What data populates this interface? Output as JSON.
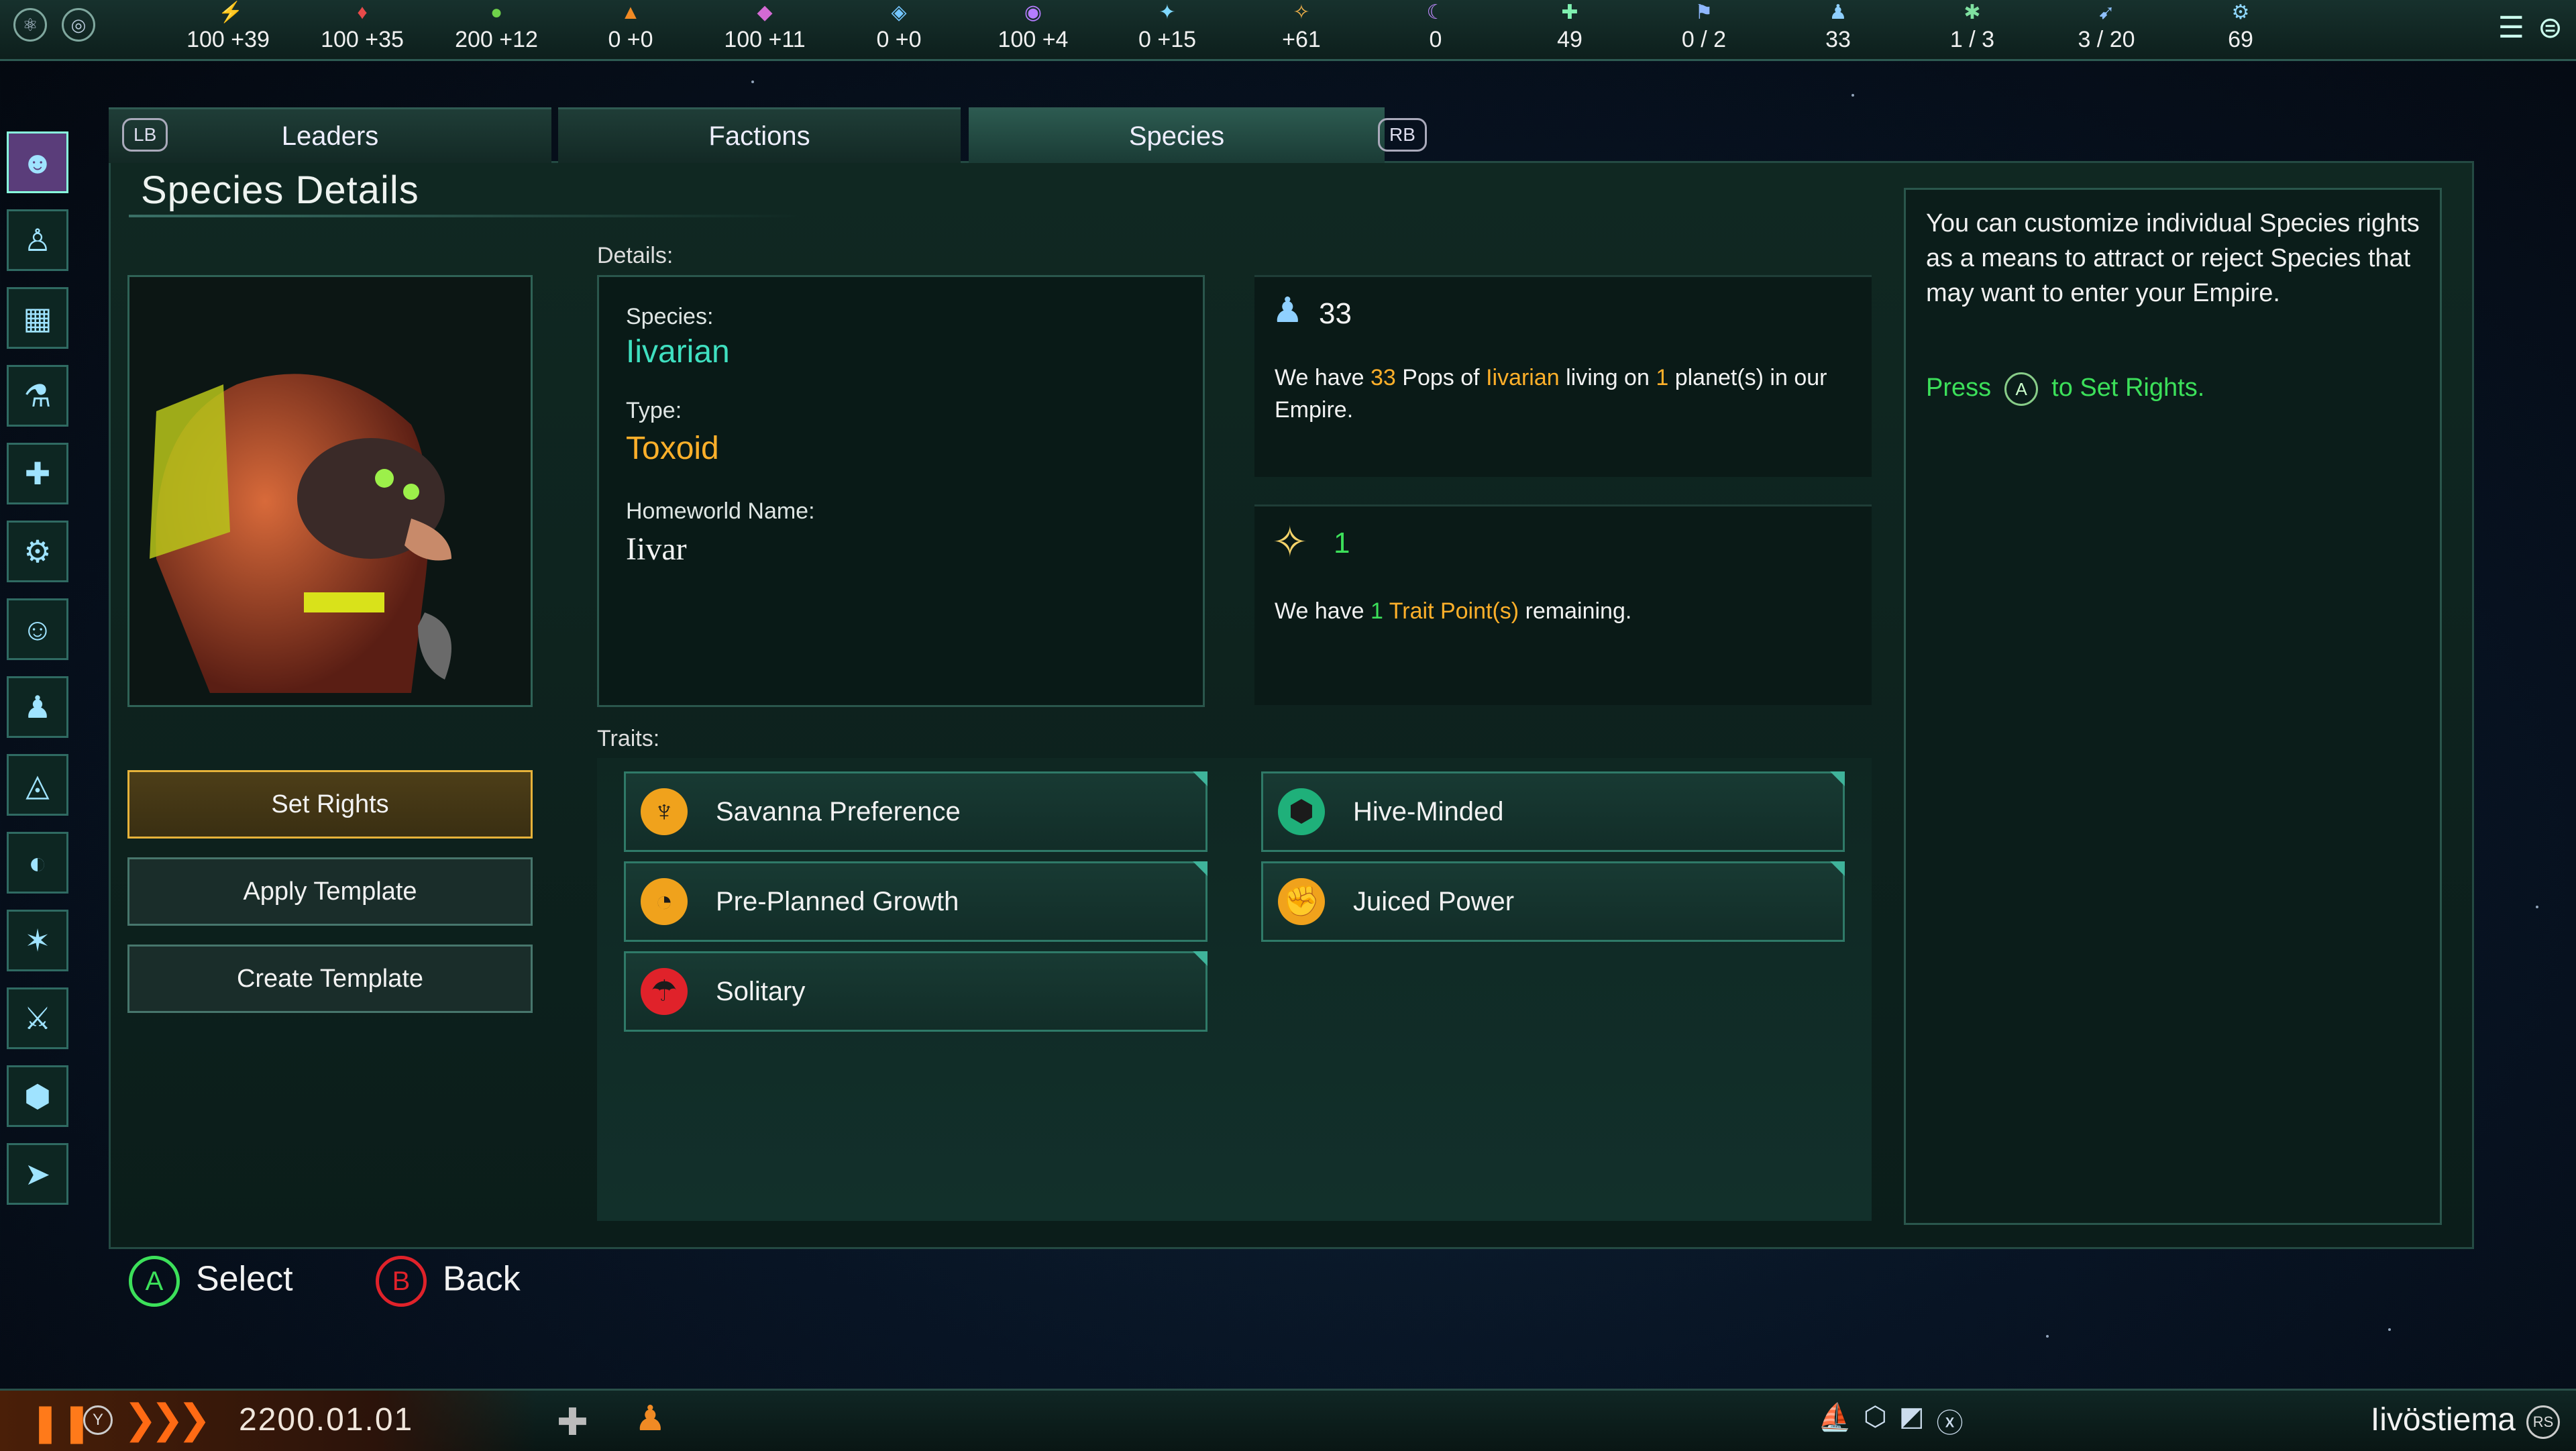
{
  "resources": [
    {
      "icon": "energy-icon",
      "glyph": "⚡",
      "color": "#f5c518",
      "value": "100 +39"
    },
    {
      "icon": "minerals-icon",
      "glyph": "♦",
      "color": "#e84a4a",
      "value": "100 +35"
    },
    {
      "icon": "food-icon",
      "glyph": "●",
      "color": "#6fd24a",
      "value": "200 +12"
    },
    {
      "icon": "consumer-goods-icon",
      "glyph": "▲",
      "color": "#f08a24",
      "value": "0 +0"
    },
    {
      "icon": "alloys-icon",
      "glyph": "◆",
      "color": "#d46ad4",
      "value": "100 +11"
    },
    {
      "icon": "unity-icon",
      "glyph": "◈",
      "color": "#74c6ff",
      "value": "0 +0"
    },
    {
      "icon": "influence-icon",
      "glyph": "◉",
      "color": "#b57cff",
      "value": "100 +4"
    },
    {
      "icon": "research-icon",
      "glyph": "✦",
      "color": "#7fd9ff",
      "value": "0 +15"
    },
    {
      "icon": "trade-icon",
      "glyph": "✧",
      "color": "#f2b24a",
      "value": "+61"
    },
    {
      "icon": "psionic-icon",
      "glyph": "☾",
      "color": "#c08aff",
      "value": "0"
    },
    {
      "icon": "stability-icon",
      "glyph": "✚",
      "color": "#7ff0b0",
      "value": "49"
    },
    {
      "icon": "planets-icon",
      "glyph": "⚑",
      "color": "#8fb8ff",
      "value": "0 / 2"
    },
    {
      "icon": "pops-icon",
      "glyph": "♟",
      "color": "#8fd0ff",
      "value": "33"
    },
    {
      "icon": "starbase-icon",
      "glyph": "✱",
      "color": "#7fe0a0",
      "value": "1 / 3"
    },
    {
      "icon": "fleet-icon",
      "glyph": "➹",
      "color": "#8fc0ff",
      "value": "3 / 20"
    },
    {
      "icon": "naval-icon",
      "glyph": "⚙",
      "color": "#8fd8ff",
      "value": "69"
    }
  ],
  "tabs": {
    "lb": "LB",
    "rb": "RB",
    "leaders": "Leaders",
    "factions": "Factions",
    "species": "Species"
  },
  "section_title": "Species Details",
  "buttons": {
    "set_rights": "Set Rights",
    "apply_template": "Apply Template",
    "create_template": "Create Template"
  },
  "details": {
    "heading": "Details:",
    "species_label": "Species:",
    "species_value": "Iivarian",
    "type_label": "Type:",
    "type_value": "Toxoid",
    "homeworld_label": "Homeworld Name:",
    "homeworld_value": "Iivar"
  },
  "pops": {
    "count": "33",
    "text_pre": "We have",
    "text_count": "33",
    "text_mid1": "Pops of",
    "text_species": "Iivarian",
    "text_mid2": "living on",
    "text_planets": "1",
    "text_post": "planet(s) in our Empire."
  },
  "trait_points": {
    "count": "1",
    "text_pre": "We have",
    "text_count": "1",
    "text_link": "Trait Point(s)",
    "text_post": "remaining."
  },
  "traits_heading": "Traits:",
  "traits": [
    {
      "label": "Savanna Preference",
      "icon": "savanna-icon",
      "glyph": "♆",
      "bg": "#f0a21c"
    },
    {
      "label": "Hive-Minded",
      "icon": "hive-icon",
      "glyph": "⬢",
      "bg": "#1fb07a"
    },
    {
      "label": "Pre-Planned Growth",
      "icon": "growth-icon",
      "glyph": "◔",
      "bg": "#f0a21c"
    },
    {
      "label": "Juiced Power",
      "icon": "juiced-power-icon",
      "glyph": "✊",
      "bg": "#f0a21c"
    },
    {
      "label": "Solitary",
      "icon": "solitary-icon",
      "glyph": "☂",
      "bg": "#e0222a"
    }
  ],
  "tooltip": {
    "text": "You can customize individual Species rights as a means to attract or reject Species that may want to enter your Empire.",
    "press": "Press",
    "button": "A",
    "press_post": "to Set Rights."
  },
  "hints": {
    "select_btn": "A",
    "select": "Select",
    "back_btn": "B",
    "back": "Back"
  },
  "bottom": {
    "y_btn": "Y",
    "date": "2200.01.01",
    "empire": "Iivöstiema"
  }
}
